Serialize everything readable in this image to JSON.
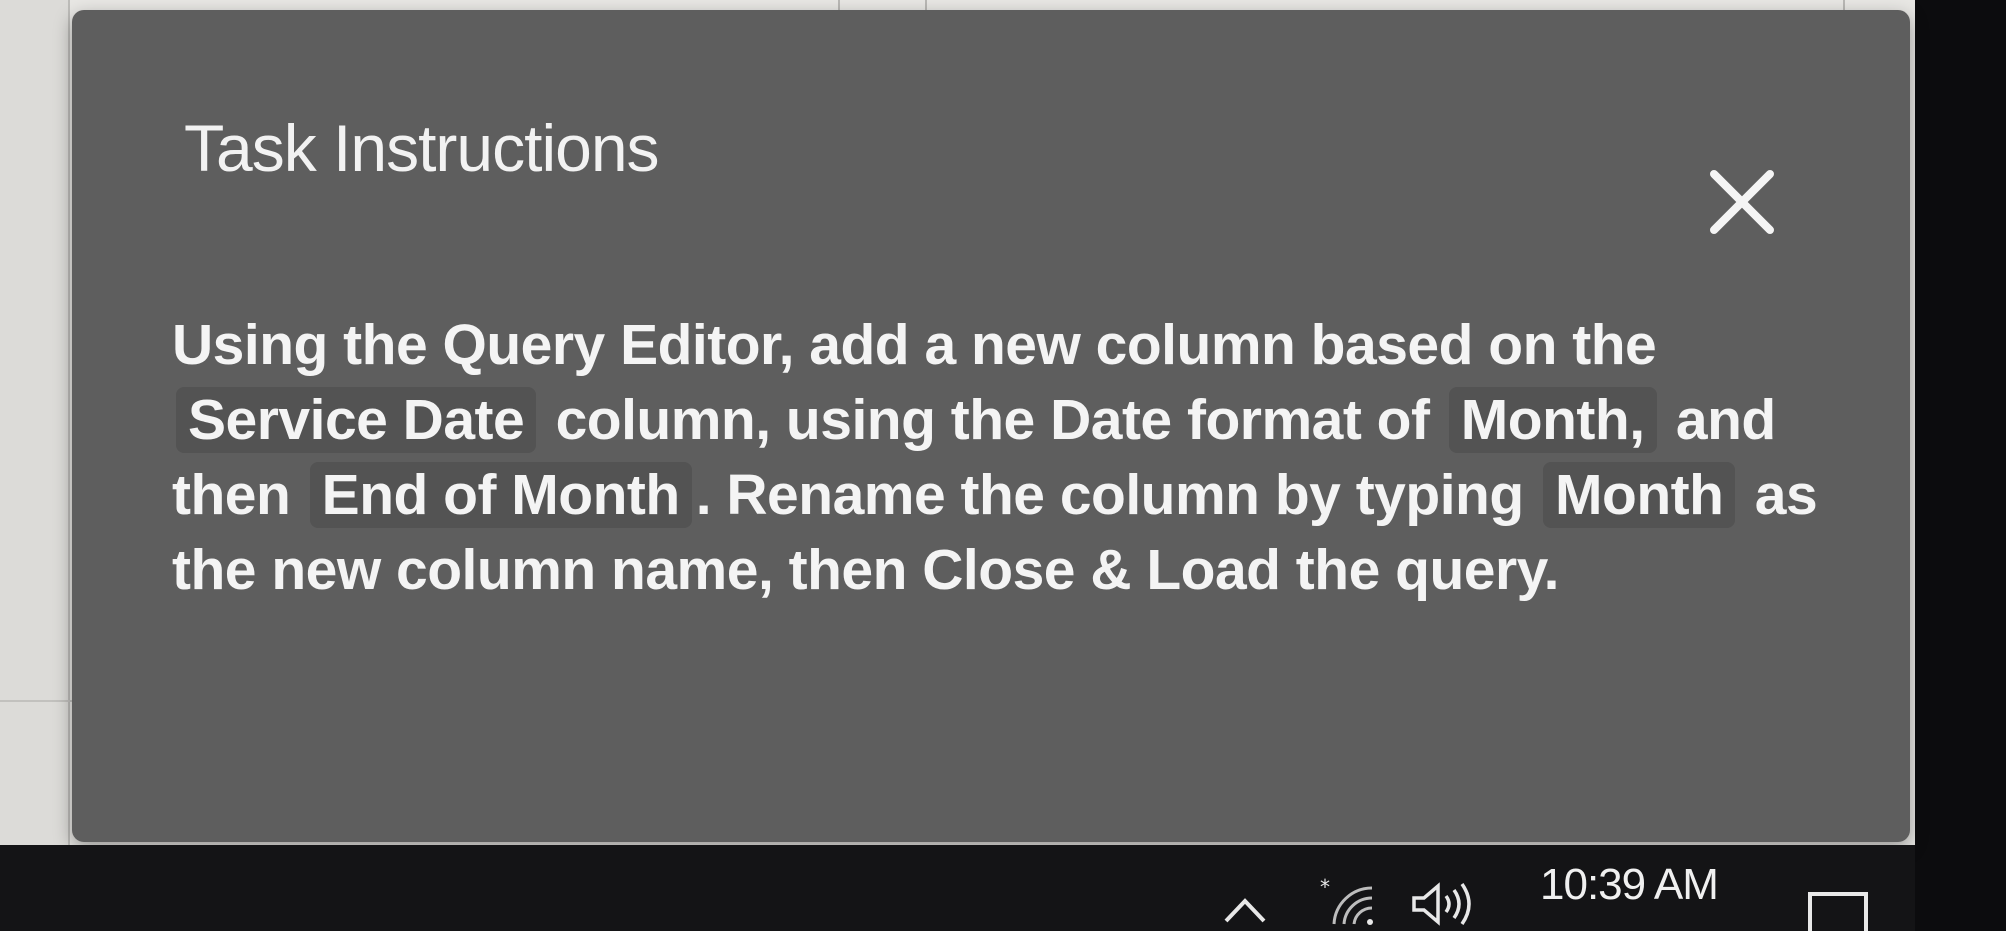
{
  "panel": {
    "title": "Task Instructions",
    "close_icon": "close-icon",
    "instruction": {
      "text_1": "Using the Query Editor, add a new column based on the",
      "chip_column": "Service Date",
      "text_2": "column, using the Date format of",
      "chip_format": "Month,",
      "text_3": "and then",
      "chip_option": "End of Month",
      "text_4": ". Rename the column by typing",
      "chip_name": "Month",
      "text_5": "as the new column name, then Close & Load the query."
    }
  },
  "taskbar": {
    "tray_icons": [
      "chevron-up-icon",
      "wifi-icon",
      "speaker-icon"
    ],
    "clock": "10:39 AM",
    "notification_icon": "notification-icon"
  },
  "colors": {
    "panel_bg": "#5e5e5e",
    "chip_bg": "#535353",
    "text": "#f4f4f4",
    "taskbar_bg": "#141416"
  }
}
